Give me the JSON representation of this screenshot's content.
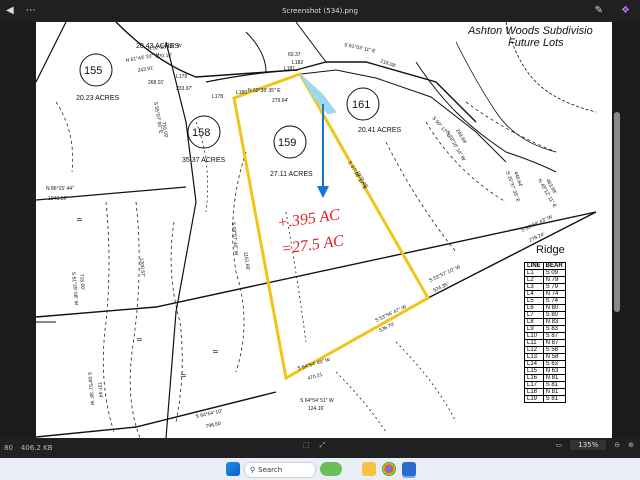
{
  "titlebar": {
    "title": "Screenshot (534).png",
    "menu_icon": "more-horizontal-icon"
  },
  "map": {
    "subdivision": [
      "Ashton Woods Subdivisio",
      "Future Lots"
    ],
    "lots": [
      {
        "num": "155",
        "acres": "20.23 ACRES"
      },
      {
        "num": "158",
        "acres": "35.37 ACRES"
      },
      {
        "num": "159",
        "acres": "27.11 ACRES"
      },
      {
        "num": "161",
        "acres": "20.41 ACRES"
      }
    ],
    "handwritten": [
      "+.395 AC",
      "=27.5 AC"
    ],
    "top_acres": "20.43 ACRES",
    "labels": {
      "l179": "L179",
      "l178": "L178",
      "l180": "L180",
      "l181": "L181",
      "l182": "L182",
      "b1": "N 69°38' 35\" E",
      "d1": "279.64'",
      "b2": "S 37°18' 17\" E",
      "d2": "1072.46'",
      "b3": "S 53°57' 10\" W",
      "d3": "524.35'",
      "b4": "S 53°56' 47\" W",
      "d4": "536.70'",
      "b5": "S 64°54' 40\" W",
      "d5": "470.21",
      "b6": "S 64°54' 51\" W",
      "d6": "124.16'",
      "b7": "1161.69'",
      "b8": "N 86°15' 44\"",
      "d8": "1043.19'",
      "b9": "S 64°54' 10\"",
      "d9": "798.50",
      "b10": "S 55°07' 00\" E",
      "d10": "716.09'",
      "b11": "S 08°57' 40\" W",
      "d11": "1200.57'",
      "b12": "S 08°51' 36\" W",
      "d12": "737.44'",
      "b13": "S 53°58' 43\" W",
      "d13": "279.24'",
      "b14": "S 28°10' 14\" W",
      "d14": "249.68'",
      "b15": "S 61°03' 11\" E",
      "d15": "218.08'",
      "b16": "N 61°43' 33\" W",
      "d16": "243.91'",
      "b17": "N 62°23' 09\" W",
      "d17": "370.16'",
      "b18": "S 25°37' 35\" E",
      "d18": "446.64'",
      "b19": "N 48°12' 11\" E",
      "d19": "463.98'",
      "b20": "S 51°29' 08\" W",
      "d20": "715.00'",
      "small": [
        "60.37",
        "268.01'",
        "233.97'",
        "S 50° 17\" E"
      ]
    }
  },
  "ridge": {
    "title": "Ridge",
    "headers": [
      "LINE",
      "BEAR"
    ],
    "rows": [
      [
        "L1",
        "S 09"
      ],
      [
        "L2",
        "N 79"
      ],
      [
        "L3",
        "S 79"
      ],
      [
        "L4",
        "N 74"
      ],
      [
        "L5",
        "S 74"
      ],
      [
        "L6",
        "N 80"
      ],
      [
        "L7",
        "S 80"
      ],
      [
        "L8",
        "N 83"
      ],
      [
        "L9",
        "S 83"
      ],
      [
        "L10",
        "S 87"
      ],
      [
        "L11",
        "N 87"
      ],
      [
        "L12",
        "S 58"
      ],
      [
        "L13",
        "N 58"
      ],
      [
        "L14",
        "S 63"
      ],
      [
        "L15",
        "N 63"
      ],
      [
        "L16",
        "N 81"
      ],
      [
        "L17",
        "S 81"
      ],
      [
        "L18",
        "N 81"
      ],
      [
        "L19",
        "S 81"
      ]
    ]
  },
  "statusbar": {
    "left1": "80",
    "filesize": "406.2 KB",
    "zoom": "135%"
  },
  "taskbar": {
    "search_placeholder": "Search"
  },
  "colors": {
    "parcel_outline": "#f0c419",
    "arrow": "#1a73d9",
    "handwriting": "#e02020",
    "highlight": "#9cd8ee"
  }
}
